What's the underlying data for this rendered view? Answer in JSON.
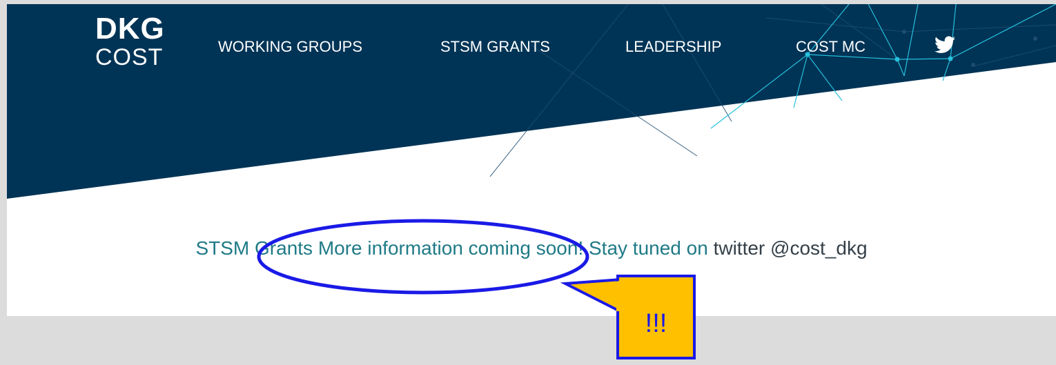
{
  "logo": {
    "line1": "DKG",
    "line2": "COST"
  },
  "nav": {
    "items": [
      {
        "label": "WORKING GROUPS"
      },
      {
        "label": "STSM GRANTS"
      },
      {
        "label": "LEADERSHIP"
      },
      {
        "label": "COST MC"
      }
    ],
    "twitter_icon": "twitter-bird-icon"
  },
  "main": {
    "message": "STSM Grants More information coming soon! Stay tuned on",
    "handle": "twitter @cost_dkg"
  },
  "annotation": {
    "callout_text": "!!!"
  },
  "colors": {
    "header_navy": "#003456",
    "link_teal": "#1f7a86",
    "network_cyan": "#27c0dd",
    "annotation_blue": "#1a1ae6",
    "annotation_yellow": "#ffc000"
  }
}
